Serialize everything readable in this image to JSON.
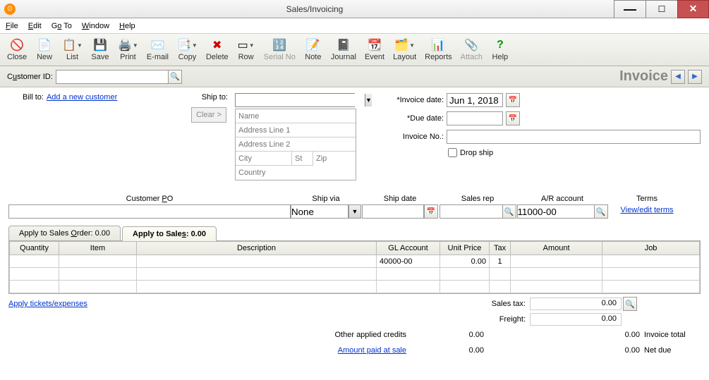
{
  "titlebar": {
    "title": "Sales/Invoicing"
  },
  "menu": {
    "file": "File",
    "edit": "Edit",
    "goto": "Go To",
    "window": "Window",
    "help": "Help"
  },
  "toolbar": {
    "close": "Close",
    "new": "New",
    "list": "List",
    "save": "Save",
    "print": "Print",
    "email": "E-mail",
    "copy": "Copy",
    "delete": "Delete",
    "row": "Row",
    "serial": "Serial No",
    "note": "Note",
    "journal": "Journal",
    "event": "Event",
    "layout": "Layout",
    "reports": "Reports",
    "attach": "Attach",
    "help": "Help"
  },
  "customer_id": {
    "label": "Customer ID:",
    "value": ""
  },
  "invoice_title": "Invoice",
  "billto": {
    "label": "Bill to:",
    "link": "Add a new customer"
  },
  "shipto": {
    "label": "Ship to:",
    "value": "",
    "clear": "Clear >",
    "name": "Name",
    "addr1": "Address Line 1",
    "addr2": "Address Line 2",
    "city": "City",
    "st": "St",
    "zip": "Zip",
    "country": "Country"
  },
  "dates": {
    "invoice_date_label": "*Invoice date:",
    "invoice_date": "Jun 1, 2018",
    "due_date_label": "*Due date:",
    "due_date": "",
    "invoice_no_label": "Invoice No.:",
    "invoice_no": "",
    "dropship": "Drop ship"
  },
  "fields2": {
    "customer_po": {
      "label": "Customer PO",
      "value": ""
    },
    "ship_via": {
      "label": "Ship via",
      "value": "None"
    },
    "ship_date": {
      "label": "Ship date",
      "value": ""
    },
    "sales_rep": {
      "label": "Sales rep",
      "value": ""
    },
    "ar_account": {
      "label": "A/R account",
      "value": "11000-00"
    },
    "terms": {
      "label": "Terms",
      "link": "View/edit terms"
    }
  },
  "tabs": {
    "apply_order": "Apply to Sales Order: 0.00",
    "apply_sales": "Apply to Sales: 0.00"
  },
  "grid": {
    "headers": {
      "quantity": "Quantity",
      "item": "Item",
      "description": "Description",
      "gl": "GL Account",
      "unit_price": "Unit Price",
      "tax": "Tax",
      "amount": "Amount",
      "job": "Job"
    },
    "rows": [
      {
        "quantity": "",
        "item": "",
        "description": "",
        "gl": "40000-00",
        "unit_price": "0.00",
        "tax": "1",
        "amount": "",
        "job": ""
      },
      {
        "quantity": "",
        "item": "",
        "description": "",
        "gl": "",
        "unit_price": "",
        "tax": "",
        "amount": "",
        "job": ""
      },
      {
        "quantity": "",
        "item": "",
        "description": "",
        "gl": "",
        "unit_price": "",
        "tax": "",
        "amount": "",
        "job": ""
      }
    ]
  },
  "footer": {
    "apply_tickets": "Apply tickets/expenses",
    "sales_tax_label": "Sales tax:",
    "sales_tax": "0.00",
    "freight_label": "Freight:",
    "freight": "0.00",
    "other_credits_label": "Other applied credits",
    "other_credits": "0.00",
    "invoice_total_label": "Invoice total",
    "invoice_total": "0.00",
    "amount_paid_link": "Amount paid at sale",
    "amount_paid": "0.00",
    "net_due_label": "Net due",
    "net_due": "0.00"
  }
}
